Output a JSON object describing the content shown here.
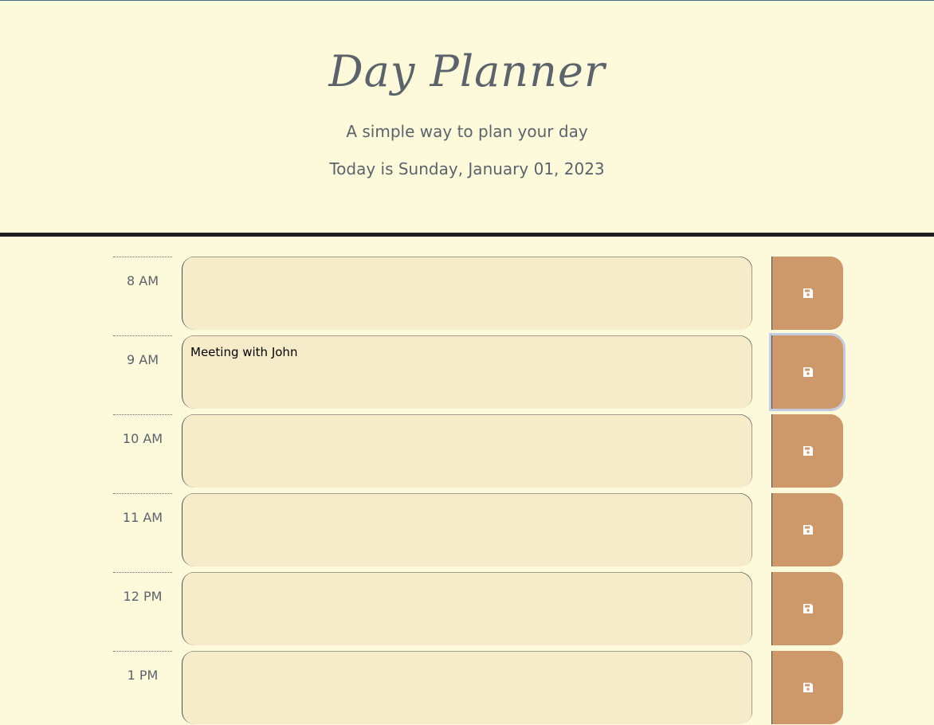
{
  "header": {
    "title": "Day Planner",
    "subtitle": "A simple way to plan your day",
    "today": "Today is Sunday, January 01, 2023"
  },
  "colors": {
    "background": "#fdfadc",
    "text": "#5c636a",
    "textarea": "#f7ecc9",
    "save_button": "#cd996b",
    "divider": "#1f1f1f"
  },
  "rows": [
    {
      "hour": "8 AM",
      "text": ""
    },
    {
      "hour": "9 AM",
      "text": "Meeting with John"
    },
    {
      "hour": "10 AM",
      "text": ""
    },
    {
      "hour": "11 AM",
      "text": ""
    },
    {
      "hour": "12 PM",
      "text": ""
    },
    {
      "hour": "1 PM",
      "text": ""
    }
  ],
  "save_icon": "floppy-disk-icon"
}
